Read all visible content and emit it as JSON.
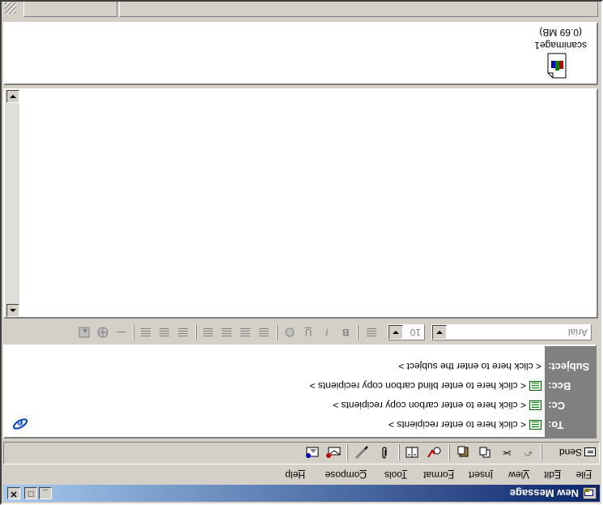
{
  "window": {
    "title": "New Message"
  },
  "caption_buttons": {
    "minimize": "_",
    "maximize": "□",
    "close": "✕"
  },
  "menu": [
    {
      "label": "File",
      "accel": "F",
      "rest": "ile"
    },
    {
      "label": "Edit",
      "accel": "E",
      "rest": "dit"
    },
    {
      "label": "View",
      "accel": "V",
      "rest": "iew"
    },
    {
      "label": "Insert",
      "accel": "I",
      "rest": "nsert"
    },
    {
      "label": "Format",
      "accel": "F",
      "rest": "ormat"
    },
    {
      "label": "Tools",
      "accel": "T",
      "rest": "ools"
    },
    {
      "label": "Compose",
      "accel": "C",
      "rest": "ompose"
    },
    {
      "label": "Help",
      "accel": "H",
      "rest": "elp"
    }
  ],
  "toolbar": {
    "send_label": "Send",
    "icons": [
      "undo-icon",
      "cut-icon",
      "copy-icon",
      "paste-icon",
      "check-names-icon",
      "address-book-icon",
      "attach-icon",
      "signature-icon",
      "priority-icon",
      "insert-picture-icon"
    ]
  },
  "header": {
    "to": {
      "label": "To:",
      "placeholder": "< click here to enter recipients >"
    },
    "cc": {
      "label": "Cc:",
      "placeholder": "< click here to enter carbon copy recipients >"
    },
    "bcc": {
      "label": "Bcc:",
      "placeholder": "< click here to enter blind carbon copy recipients >"
    },
    "subject": {
      "label": "Subject:",
      "placeholder": "< click here to enter the subject >"
    }
  },
  "format": {
    "font": "Arial",
    "size": "10",
    "bold": "B",
    "italic": "I",
    "underline": "U"
  },
  "attachment": {
    "name": "scanimage1",
    "size": "(0.69 MB)"
  }
}
